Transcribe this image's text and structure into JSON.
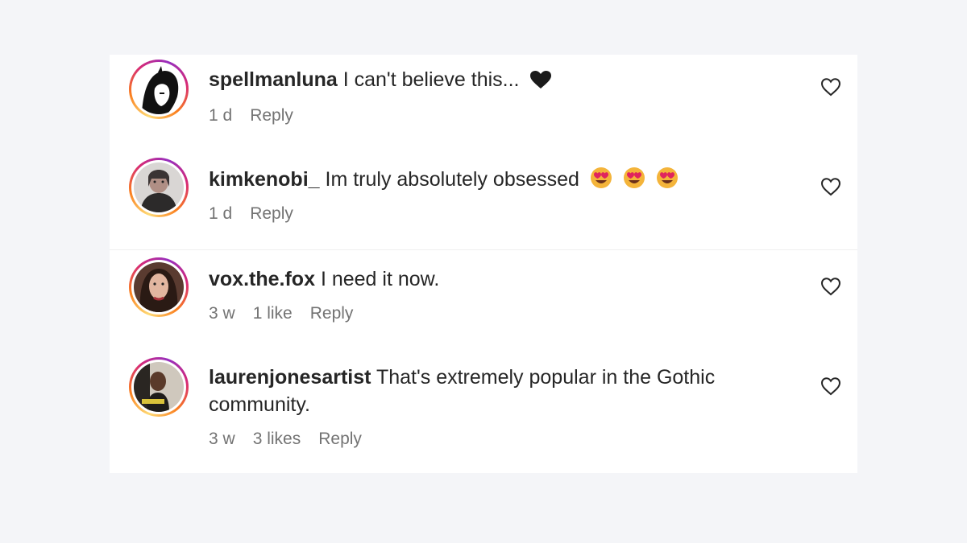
{
  "comments": [
    {
      "username": "spellmanluna",
      "text": "I can't believe this...",
      "emoji_names": [
        "black-heart-icon"
      ],
      "time": "1 d",
      "likes": "",
      "reply_label": "Reply"
    },
    {
      "username": "kimkenobi_",
      "text": "Im truly absolutely obsessed",
      "emoji_names": [
        "heart-eyes-emoji-icon",
        "heart-eyes-emoji-icon",
        "heart-eyes-emoji-icon"
      ],
      "time": "1 d",
      "likes": "",
      "reply_label": "Reply"
    },
    {
      "username": "vox.the.fox",
      "text": "I need it now.",
      "emoji_names": [],
      "time": "3 w",
      "likes": "1 like",
      "reply_label": "Reply"
    },
    {
      "username": "laurenjonesartist",
      "text": "That's extremely popular in the Gothic community.",
      "emoji_names": [],
      "time": "3 w",
      "likes": "3 likes",
      "reply_label": "Reply"
    }
  ],
  "colors": {
    "page_bg": "#f4f5f8",
    "panel_bg": "#ffffff",
    "text_primary": "#262626",
    "text_secondary": "#737373",
    "story_ring": [
      "#feda75",
      "#fa7e1e",
      "#d62976",
      "#962fbf"
    ]
  }
}
